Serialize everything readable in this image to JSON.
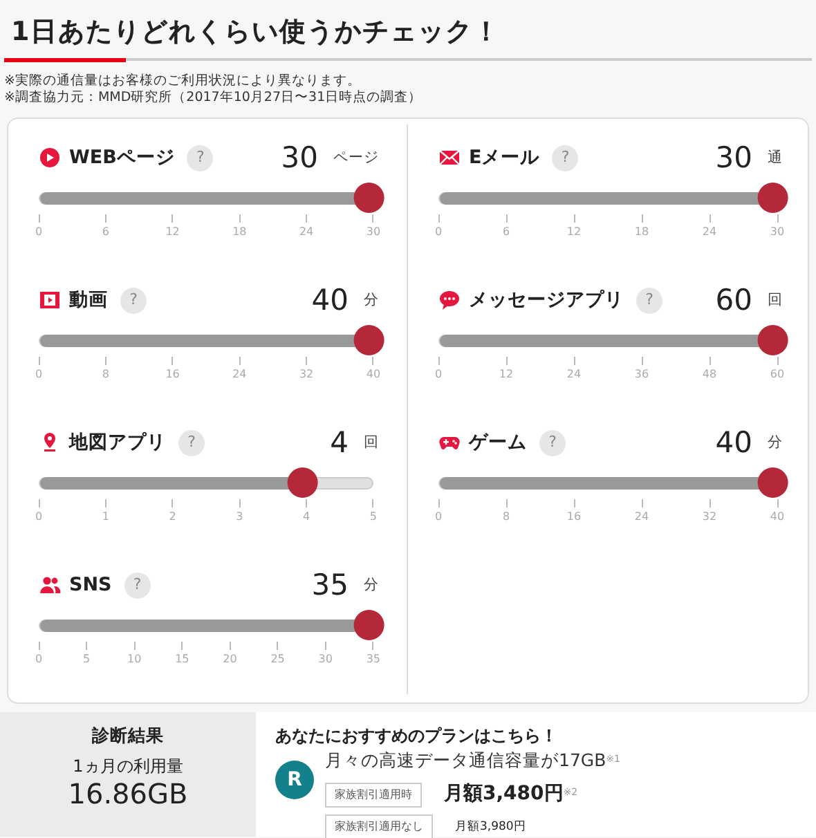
{
  "title": "1日あたりどれくらい使うかチェック！",
  "notes": [
    "※実際の通信量はお客様のご利用状況により異なります。",
    "※調査協力元：MMD研究所（2017年10月27日〜31日時点の調査）"
  ],
  "meters": [
    {
      "kind": "web",
      "label": "WEBページ",
      "help": "?",
      "value": "30",
      "unit": "ページ",
      "level": 1,
      "ticks": [
        "0",
        "6",
        "12",
        "18",
        "24",
        "30"
      ]
    },
    {
      "kind": "mail",
      "label": "Eメール",
      "help": "?",
      "value": "30",
      "unit": "通",
      "level": 1,
      "ticks": [
        "0",
        "6",
        "12",
        "18",
        "24",
        "30"
      ]
    },
    {
      "kind": "video",
      "label": "動画",
      "help": "?",
      "value": "40",
      "unit": "分",
      "level": 1,
      "ticks": [
        "0",
        "8",
        "16",
        "24",
        "32",
        "40"
      ]
    },
    {
      "kind": "message",
      "label": "メッセージアプリ",
      "help": "?",
      "value": "60",
      "unit": "回",
      "level": 1,
      "ticks": [
        "0",
        "12",
        "24",
        "36",
        "48",
        "60"
      ]
    },
    {
      "kind": "map",
      "label": "地図アプリ",
      "help": "?",
      "value": "4",
      "unit": "回",
      "level": 0.8,
      "ticks": [
        "0",
        "1",
        "2",
        "3",
        "4",
        "5"
      ]
    },
    {
      "kind": "game",
      "label": "ゲーム",
      "help": "?",
      "value": "40",
      "unit": "分",
      "level": 1,
      "ticks": [
        "0",
        "8",
        "16",
        "24",
        "32",
        "40"
      ]
    },
    {
      "kind": "sns",
      "label": "SNS",
      "help": "?",
      "value": "35",
      "unit": "分",
      "level": 1,
      "ticks": [
        "0",
        "5",
        "10",
        "15",
        "20",
        "25",
        "30",
        "35"
      ]
    }
  ],
  "result": {
    "heading": "診断結果",
    "label": "1ヵ月の利用量",
    "amount": "16.86GB"
  },
  "plan": {
    "heading": "あなたにおすすめのプランはこちら！",
    "logo_letter": "R",
    "capacity": "月々の高速データ通信容量が17GB$^{※1}$",
    "prices": [
      {
        "tag": "家族割引適用時",
        "price": "月額3,480円$^{※2}$",
        "kind": "main"
      },
      {
        "tag": "家族割引適用なし",
        "price": "月額3,980円",
        "kind": "sub"
      }
    ]
  }
}
